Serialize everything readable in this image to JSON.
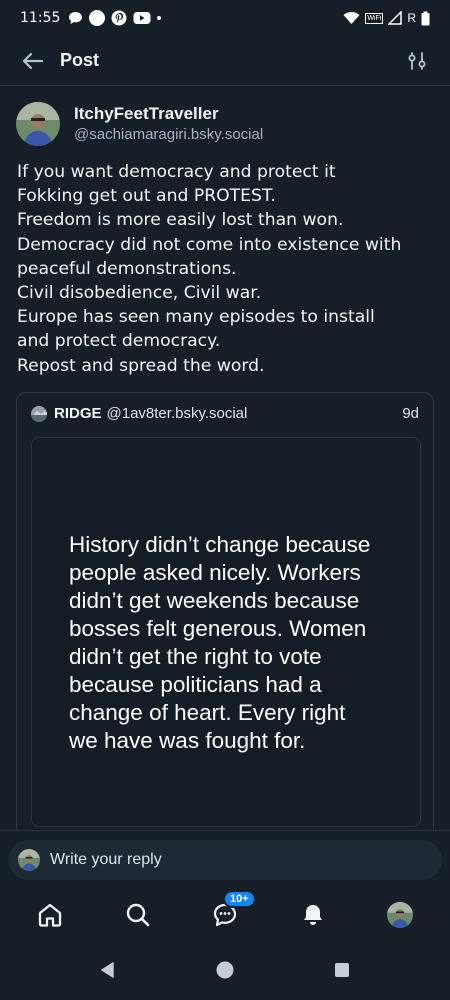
{
  "status_bar": {
    "time": "11:55",
    "wifi_badge": "WiFi",
    "roaming": "R",
    "icons": [
      "chat-bubble-icon",
      "circle-icon",
      "pinterest-icon",
      "youtube-icon",
      "wifi-icon",
      "signal-icon",
      "battery-icon"
    ]
  },
  "header": {
    "title": "Post"
  },
  "post": {
    "author": {
      "display_name": "ItchyFeetTraveller",
      "handle": "@sachiamaragiri.bsky.social"
    },
    "lines": [
      "If you want democracy and protect it",
      "Fokking get out and PROTEST.",
      "Freedom is more easily lost than won.",
      "Democracy did not come into existence with",
      "peaceful demonstrations.",
      "Civil disobedience, Civil war.",
      "Europe has seen many episodes to install",
      "and protect democracy.",
      "Repost and spread the word."
    ]
  },
  "quote": {
    "name": "RIDGE",
    "handle": "@1av8ter.bsky.social",
    "time": "9d",
    "image_lines": [
      "History didn’t change because",
      "people asked nicely. Workers",
      "didn’t get weekends because",
      "bosses felt generous. Women",
      "didn’t get the right to vote",
      "because politicians had a",
      "change of heart. Every right",
      "we have was fought for."
    ]
  },
  "reply": {
    "placeholder": "Write your reply"
  },
  "bottom_nav": {
    "items": [
      "home-icon",
      "search-icon",
      "chat-icon",
      "notifications-icon",
      "profile-avatar"
    ],
    "chat_badge": "10+"
  },
  "colors": {
    "background": "#161e27",
    "accent": "#1185fe",
    "muted_text": "#a7b3c1"
  }
}
